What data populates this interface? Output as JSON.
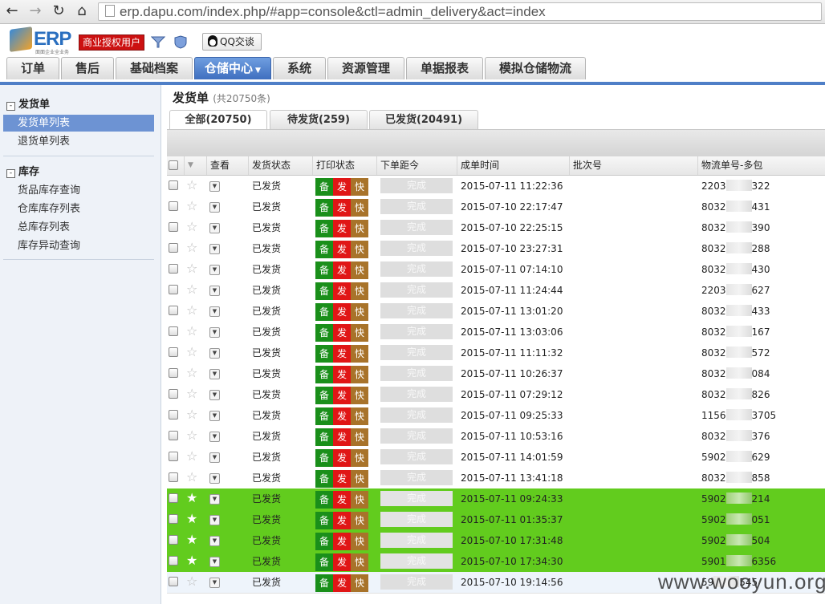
{
  "browser": {
    "url": "erp.dapu.com/index.php/#app=console&ctl=admin_delivery&act=index"
  },
  "header": {
    "logo_text": "ERP",
    "logo_sub": "面面企业全业务",
    "license": "商业授权用户",
    "qq": "QQ交谈"
  },
  "nav": {
    "tabs": [
      {
        "label": "订单"
      },
      {
        "label": "售后"
      },
      {
        "label": "基础档案"
      },
      {
        "label": "仓储中心",
        "active": true
      },
      {
        "label": "系统"
      },
      {
        "label": "资源管理"
      },
      {
        "label": "单据报表"
      },
      {
        "label": "模拟仓储物流"
      }
    ]
  },
  "sidebar": {
    "groups": [
      {
        "title": "发货单",
        "items": [
          {
            "label": "发货单列表",
            "active": true
          },
          {
            "label": "退货单列表"
          }
        ]
      },
      {
        "title": "库存",
        "items": [
          {
            "label": "货品库存查询"
          },
          {
            "label": "仓库库存列表"
          },
          {
            "label": "总库存列表"
          },
          {
            "label": "库存异动查询"
          }
        ]
      }
    ]
  },
  "page": {
    "title": "发货单",
    "count": "(共20750条)",
    "subtabs": [
      "全部(20750)",
      "待发货(259)",
      "已发货(20491)"
    ]
  },
  "table": {
    "headers": [
      "查看",
      "发货状态",
      "打印状态",
      "下单距今",
      "成单时间",
      "批次号",
      "物流单号-多包"
    ],
    "print_labels": [
      "备",
      "发",
      "快"
    ],
    "done_label": "完成",
    "rows": [
      {
        "status": "已发货",
        "time": "2015-07-11 11:22:36",
        "track_pre": "2203",
        "track_suf": "322",
        "hl": false
      },
      {
        "status": "已发货",
        "time": "2015-07-10 22:17:47",
        "track_pre": "8032",
        "track_suf": "431",
        "hl": false
      },
      {
        "status": "已发货",
        "time": "2015-07-10 22:25:15",
        "track_pre": "8032",
        "track_suf": "390",
        "hl": false
      },
      {
        "status": "已发货",
        "time": "2015-07-10 23:27:31",
        "track_pre": "8032",
        "track_suf": "288",
        "hl": false
      },
      {
        "status": "已发货",
        "time": "2015-07-11 07:14:10",
        "track_pre": "8032",
        "track_suf": "430",
        "hl": false
      },
      {
        "status": "已发货",
        "time": "2015-07-11 11:24:44",
        "track_pre": "2203",
        "track_suf": "627",
        "hl": false
      },
      {
        "status": "已发货",
        "time": "2015-07-11 13:01:20",
        "track_pre": "8032",
        "track_suf": "433",
        "hl": false
      },
      {
        "status": "已发货",
        "time": "2015-07-11 13:03:06",
        "track_pre": "8032",
        "track_suf": "167",
        "hl": false
      },
      {
        "status": "已发货",
        "time": "2015-07-11 11:11:32",
        "track_pre": "8032",
        "track_suf": "572",
        "hl": false
      },
      {
        "status": "已发货",
        "time": "2015-07-11 10:26:37",
        "track_pre": "8032",
        "track_suf": "084",
        "hl": false
      },
      {
        "status": "已发货",
        "time": "2015-07-11 07:29:12",
        "track_pre": "8032",
        "track_suf": "826",
        "hl": false
      },
      {
        "status": "已发货",
        "time": "2015-07-11 09:25:33",
        "track_pre": "1156",
        "track_suf": "3705",
        "hl": false
      },
      {
        "status": "已发货",
        "time": "2015-07-11 10:53:16",
        "track_pre": "8032",
        "track_suf": "376",
        "hl": false
      },
      {
        "status": "已发货",
        "time": "2015-07-11 14:01:59",
        "track_pre": "5902",
        "track_suf": "629",
        "hl": false
      },
      {
        "status": "已发货",
        "time": "2015-07-11 13:41:18",
        "track_pre": "8032",
        "track_suf": "858",
        "hl": false
      },
      {
        "status": "已发货",
        "time": "2015-07-11 09:24:33",
        "track_pre": "5902",
        "track_suf": "214",
        "hl": true
      },
      {
        "status": "已发货",
        "time": "2015-07-11 01:35:37",
        "track_pre": "5902",
        "track_suf": "051",
        "hl": true
      },
      {
        "status": "已发货",
        "time": "2015-07-10 17:31:48",
        "track_pre": "5902",
        "track_suf": "504",
        "hl": true
      },
      {
        "status": "已发货",
        "time": "2015-07-10 17:34:30",
        "track_pre": "5901",
        "track_suf": "6356",
        "hl": true
      },
      {
        "status": "已发货",
        "time": "2015-07-10 19:14:56",
        "track_pre": "59",
        "track_suf": "545",
        "hl": false
      }
    ]
  },
  "watermark": "www.wooyun.org",
  "colors": {
    "nav_active": "#4f7fc7",
    "row_highlight": "#62cc1e",
    "tag_green": "#1a8f1a",
    "tag_red": "#e01616",
    "tag_brown": "#a8732a"
  }
}
